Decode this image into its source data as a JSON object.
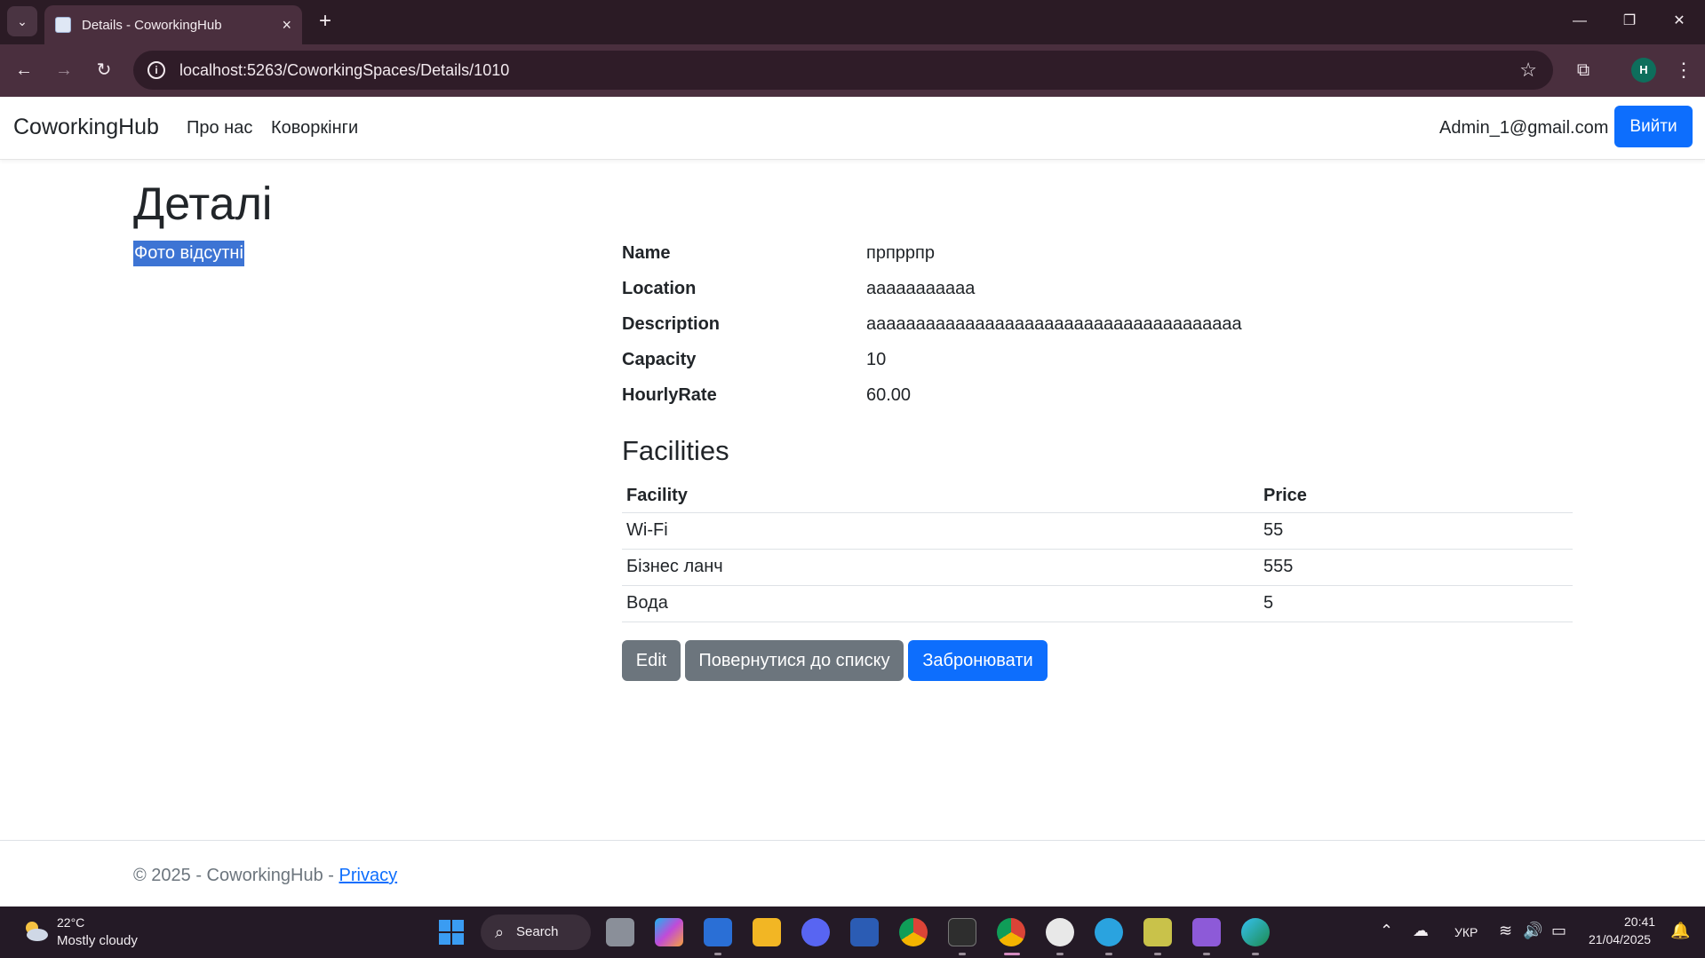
{
  "browser": {
    "tab_title": "Details - CoworkingHub",
    "url": "localhost:5263/CoworkingSpaces/Details/1010",
    "profile_initial": "H",
    "tab_menu_icon": "chevron-down-icon",
    "minimize_icon": "minimize-icon",
    "restore_icon": "restore-icon",
    "close_icon": "close-icon"
  },
  "navbar": {
    "brand": "CoworkingHub",
    "links": [
      "Про нас",
      "Коворкінги"
    ],
    "user_email": "Admin_1@gmail.com",
    "logout_label": "Вийти"
  },
  "details": {
    "title": "Деталі",
    "no_photo": "Фото відсутні",
    "fields": [
      {
        "term": "Name",
        "value": "прпррпр"
      },
      {
        "term": "Location",
        "value": "ааааааааааа"
      },
      {
        "term": "Description",
        "value": "аааааааааааааааааааааааааааааааааааааа"
      },
      {
        "term": "Capacity",
        "value": "10"
      },
      {
        "term": "HourlyRate",
        "value": "60.00"
      }
    ]
  },
  "facilities": {
    "title": "Facilities",
    "headers": [
      "Facility",
      "Price"
    ],
    "rows": [
      [
        "Wi-Fi",
        "55"
      ],
      [
        "Бізнес ланч",
        "555"
      ],
      [
        "Вода",
        "5"
      ]
    ]
  },
  "actions": {
    "edit": "Edit",
    "back": "Повернутися до списку",
    "book": "Забронювати"
  },
  "footer": {
    "text": "© 2025 - CoworkingHub - ",
    "privacy": "Privacy"
  },
  "taskbar": {
    "temperature": "22°C",
    "weather": "Mostly cloudy",
    "search_label": "Search",
    "language": "УКР",
    "time": "20:41",
    "date": "21/04/2025"
  },
  "colors": {
    "primary": "#0d6efd",
    "secondary": "#6c757d",
    "selection": "#3d74d4",
    "browser_frame": "#4a2f3e"
  }
}
